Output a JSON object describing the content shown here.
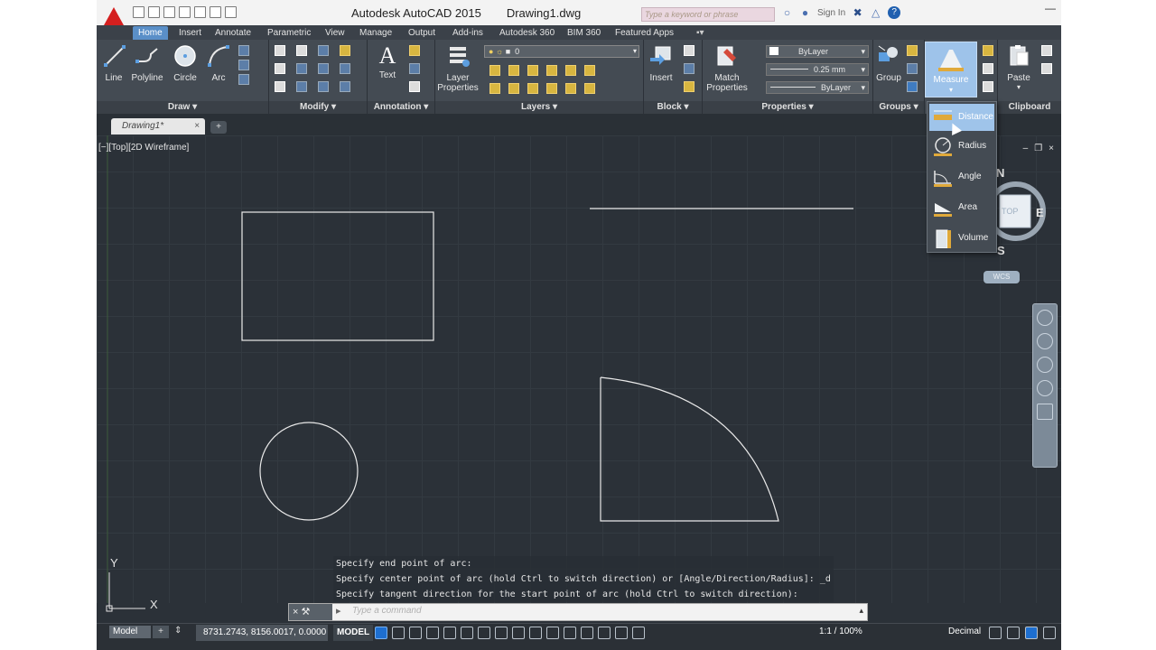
{
  "titlebar": {
    "app_name": "Autodesk AutoCAD 2015",
    "document": "Drawing1.dwg",
    "search_placeholder": "Type a keyword or phrase",
    "signin": "Sign In"
  },
  "ribbon_tabs": [
    "Home",
    "Insert",
    "Annotate",
    "Parametric",
    "View",
    "Manage",
    "Output",
    "Add-ins",
    "Autodesk 360",
    "BIM 360",
    "Featured Apps"
  ],
  "panels": {
    "draw": {
      "title": "Draw",
      "buttons": [
        "Line",
        "Polyline",
        "Circle",
        "Arc"
      ]
    },
    "modify": {
      "title": "Modify"
    },
    "annotation": {
      "title": "Annotation",
      "text_label": "Text"
    },
    "layers": {
      "title": "Layers",
      "layer_properties": "Layer Properties",
      "current_layer": "0"
    },
    "block": {
      "title": "Block",
      "insert": "Insert"
    },
    "properties": {
      "title": "Properties",
      "match": "Match Properties",
      "color": "ByLayer",
      "lineweight": "0.25 mm",
      "linetype": "ByLayer"
    },
    "groups": {
      "title": "Groups",
      "group": "Group"
    },
    "utilities": {
      "measure": "Measure"
    },
    "clipboard": {
      "title": "Clipboard",
      "paste": "Paste"
    }
  },
  "measure_menu": {
    "items": [
      "Distance",
      "Radius",
      "Angle",
      "Area",
      "Volume"
    ],
    "highlighted": "Distance"
  },
  "document_tabs": {
    "active": "Drawing1*"
  },
  "viewport": {
    "label": "[−][Top][2D Wireframe]",
    "viewcube": {
      "n": "N",
      "e": "E",
      "s": "S",
      "face": "TOP",
      "wcs": "WCS"
    },
    "ucs": {
      "x": "X",
      "y": "Y"
    }
  },
  "command_history": [
    "Specify end point of arc:",
    "Specify center point of arc (hold Ctrl to switch direction) or [Angle/Direction/Radius]: _d",
    "Specify tangent direction for the start point of arc (hold Ctrl to switch direction):"
  ],
  "command_line": {
    "placeholder": "Type a command"
  },
  "statusbar": {
    "model_tab": "Model",
    "coords": "8731.2743, 8156.0017, 0.0000",
    "space": "MODEL",
    "anno_scale": "1:1 / 100%",
    "units": "Decimal"
  },
  "colors": {
    "ribbon_bg": "#444b53",
    "canvas_bg": "#2b3138",
    "tab_active": "#5a8fc8",
    "logo_red": "#d41f1f",
    "highlight": "#9fc4ea"
  }
}
